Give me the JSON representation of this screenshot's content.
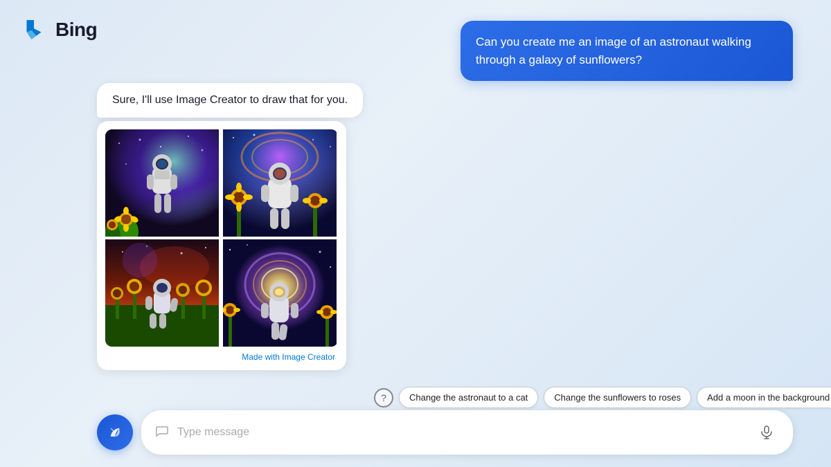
{
  "header": {
    "logo_alt": "Bing logo",
    "title": "Bing"
  },
  "user_message": {
    "text": "Can you create me an image of an astronaut walking through a galaxy of sunflowers?"
  },
  "assistant_message": {
    "text": "Sure, I'll use Image Creator to draw that for you."
  },
  "image_grid": {
    "credit_prefix": "Made with ",
    "credit_link": "Image Creator"
  },
  "suggestions": {
    "help_icon": "?",
    "chips": [
      "Change the astronaut to a cat",
      "Change the sunflowers to roses",
      "Add a moon in the background"
    ]
  },
  "input_bar": {
    "placeholder": "Type message"
  },
  "copilot_button": {
    "label": "Copilot"
  }
}
